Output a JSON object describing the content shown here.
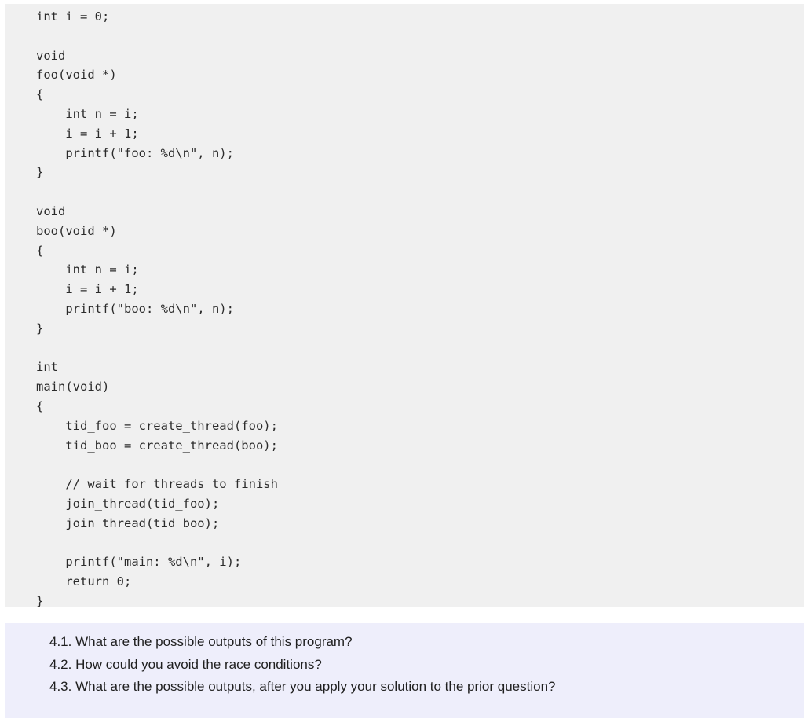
{
  "code": {
    "language": "c",
    "lines": [
      "int i = 0;",
      "",
      "void",
      "foo(void *)",
      "{",
      "    int n = i;",
      "    i = i + 1;",
      "    printf(\"foo: %d\\n\", n);",
      "}",
      "",
      "void",
      "boo(void *)",
      "{",
      "    int n = i;",
      "    i = i + 1;",
      "    printf(\"boo: %d\\n\", n);",
      "}",
      "",
      "int",
      "main(void)",
      "{",
      "    tid_foo = create_thread(foo);",
      "    tid_boo = create_thread(boo);",
      "",
      "    // wait for threads to finish",
      "    join_thread(tid_foo);",
      "    join_thread(tid_boo);",
      "",
      "    printf(\"main: %d\\n\", i);",
      "    return 0;",
      "}"
    ]
  },
  "questions": [
    "4.1. What are the possible outputs of this program?",
    "4.2. How could you avoid the race conditions?",
    "4.3. What are the possible outputs, after you apply your solution to the prior question?"
  ]
}
